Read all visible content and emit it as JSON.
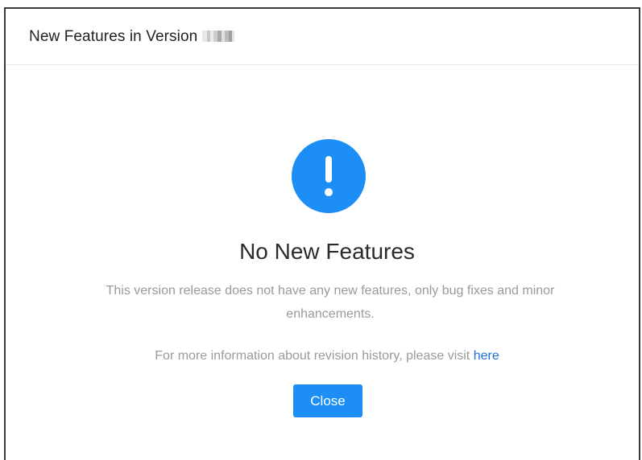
{
  "dialog": {
    "title": "New Features in Version",
    "version_redacted": true,
    "accent_color": "#1e8ef7",
    "link_color": "#1e6fd9"
  },
  "body": {
    "icon": "exclamation-circle-icon",
    "heading": "No New Features",
    "message": "This version release does not have any new features, only bug fixes and minor enhancements.",
    "more_info_prefix": "For more information about revision history, please visit ",
    "more_info_link": "here",
    "close_label": "Close"
  }
}
